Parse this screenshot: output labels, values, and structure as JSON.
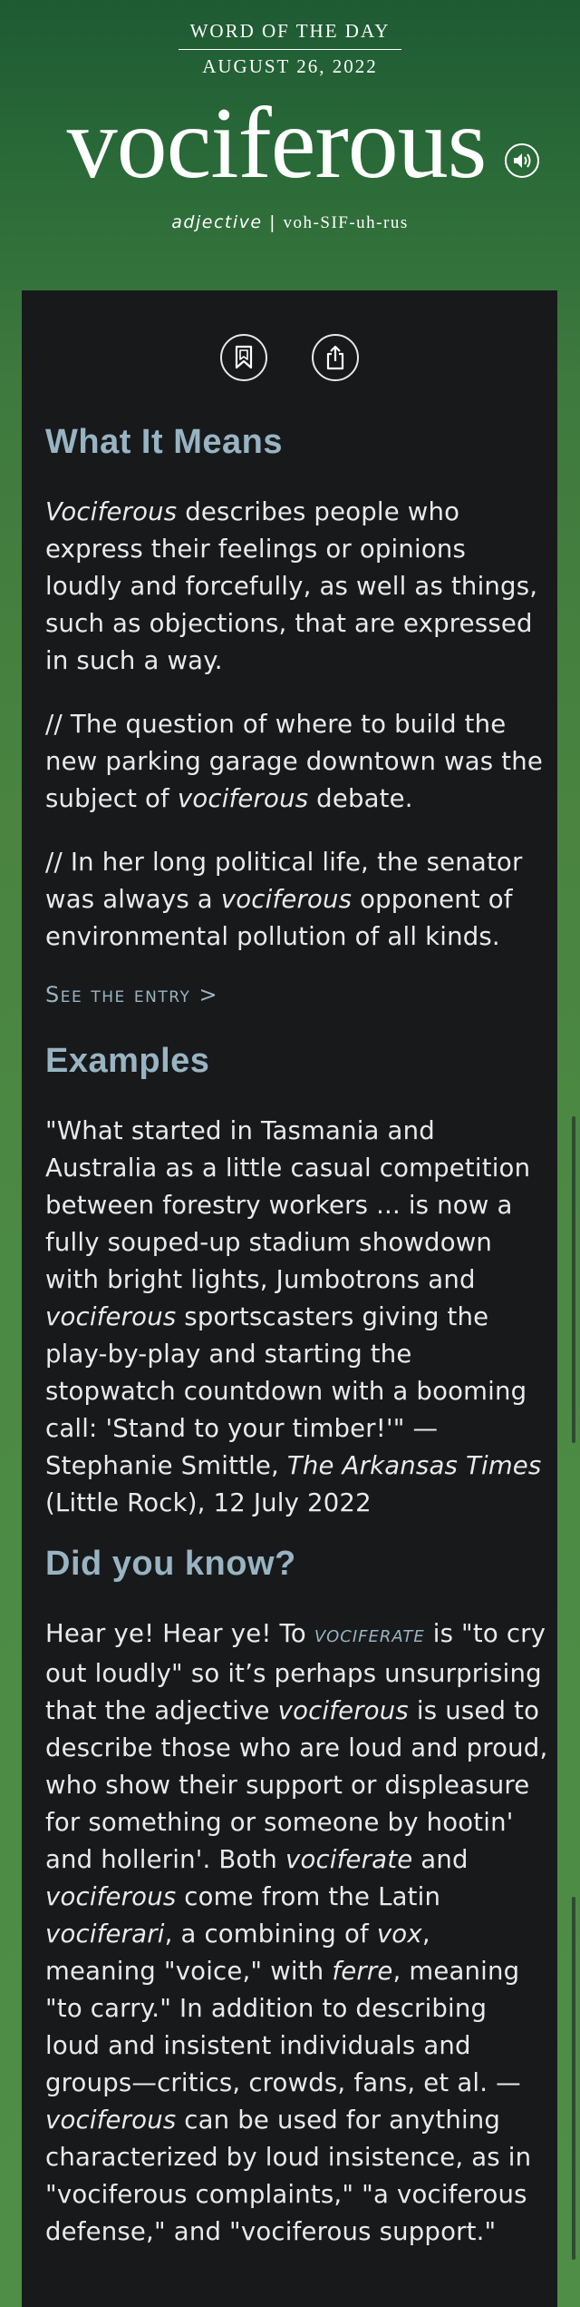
{
  "header": {
    "title": "WORD OF THE DAY",
    "date": "AUGUST 26, 2022",
    "word": "vociferous",
    "part_of_speech": "adjective",
    "separator": "|",
    "pronunciation": "voh-SIF-uh-rus"
  },
  "icons": {
    "speaker": "speaker-icon",
    "bookmark": "bookmark-icon",
    "share": "share-icon"
  },
  "meaning": {
    "title": "What It Means",
    "def": {
      "word": "Vociferous",
      "rest": " describes people who express their feelings or opinions loudly and forcefully, as well as things, such as objections, that are expressed in such a way."
    },
    "ex1": {
      "before": "// The question of where to build the new parking garage downtown was the subject of ",
      "word": "vociferous",
      "after": " debate."
    },
    "ex2": {
      "before": "// In her long political life, the senator was always a ",
      "word": "vociferous",
      "after": " opponent of environmental pollution of all kinds."
    },
    "link": "See the entry >"
  },
  "examples": {
    "title": "Examples",
    "p1": "\"What started in Tasmania and Australia as a little casual competition between forestry workers ... is now a fully souped-up stadium showdown with bright lights, Jumbotrons and ",
    "word": "vociferous",
    "p2": " sportscasters giving the play-by-play and starting the stopwatch countdown with a booming call: 'Stand to your timber!'\" — Stephanie Smittle, ",
    "source": "The Arkansas Times",
    "p3": " (Little Rock), 12 July 2022"
  },
  "did_you_know": {
    "title": "Did you know?",
    "t1": "Hear ye! Hear ye! To ",
    "link": "vociferate",
    "t2": " is \"to cry out loudly\" so it’s perhaps unsurprising that the adjective ",
    "w1": "vociferous",
    "t3": " is used to describe those who are loud and proud, who show their support or displeasure for something or someone by hootin' and hollerin'. Both ",
    "w2": "vociferate",
    "t4": " and ",
    "w3": "vociferous",
    "t5": " come from the Latin ",
    "w4": "vociferari",
    "t6": ", a combining of ",
    "w5": "vox",
    "t7": ", meaning \"voice,\" with ",
    "w6": "ferre",
    "t8": ", meaning \"to carry.\" In addition to describing loud and insistent individuals and groups—critics, crowds, fans, et al. —",
    "w7": "vociferous",
    "t9": " can be used for anything characterized by loud insistence, as in \"vociferous complaints,\" \"a vociferous defense,\" and \"vociferous support.\""
  },
  "colors": {
    "background": "#2f6b3a",
    "card": "#18191b",
    "heading": "#98b4c2",
    "text": "#eaeaea"
  }
}
